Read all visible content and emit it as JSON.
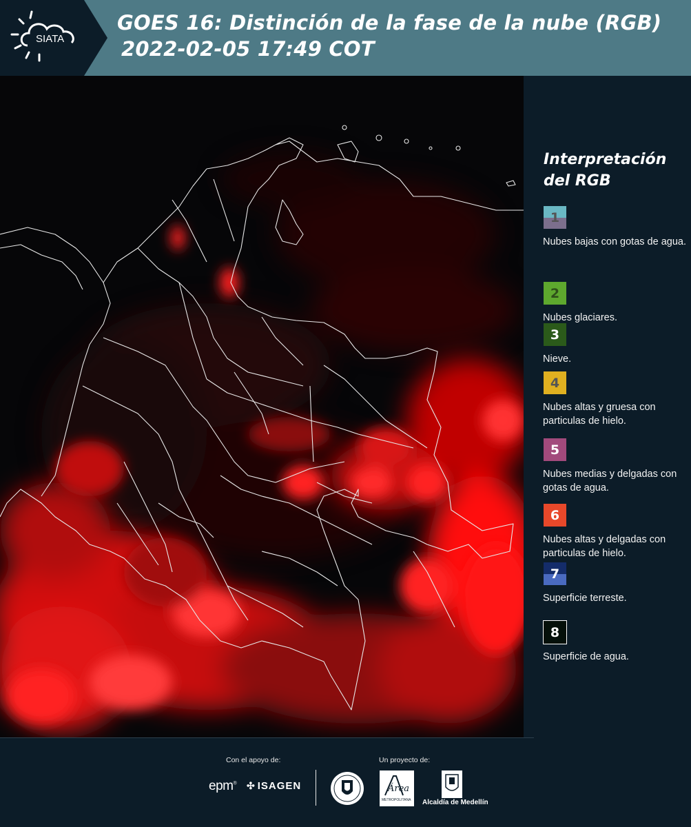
{
  "header": {
    "logo_text": "SIATA",
    "title_line1": "GOES 16: Distinción de la fase de la nube (RGB)",
    "title_line2": "2022-02-05 17:49 COT"
  },
  "legend": {
    "title": "Interpretación del RGB",
    "items": [
      {
        "number": "1",
        "label": "Nubes bajas con gotas de agua.",
        "color_top": "#6ab8c4",
        "color_bottom": "#7c6f8d",
        "number_color": "#555555"
      },
      {
        "number": "2",
        "label": "Nubes glaciares.",
        "color_top": "#5ea82e",
        "color_bottom": "#5ea82e",
        "number_color": "#2f4f1a"
      },
      {
        "number": "3",
        "label": "Nieve.",
        "color_top": "#2b5a1a",
        "color_bottom": "#2b5a1a",
        "number_color": "#ffffff"
      },
      {
        "number": "4",
        "label": "Nubes altas y gruesa con particulas de hielo.",
        "color_top": "#e0b020",
        "color_bottom": "#e0b020",
        "number_color": "#555555"
      },
      {
        "number": "5",
        "label": "Nubes medias y delgadas con gotas de agua.",
        "color_top": "#a24a7c",
        "color_bottom": "#a24a7c",
        "number_color": "#ffffff"
      },
      {
        "number": "6",
        "label": "Nubes altas y delgadas con particulas de hielo.",
        "color_top": "#e8482a",
        "color_bottom": "#e8482a",
        "number_color": "#ffffff"
      },
      {
        "number": "7",
        "label": "Superficie terreste.",
        "color_top": "#142c6a",
        "color_bottom": "#4a6ac0",
        "number_color": "#ffffff"
      },
      {
        "number": "8",
        "label": "Superficie de agua.",
        "color_top": "#05100a",
        "color_bottom": "#05100a",
        "number_color": "#ffffff"
      }
    ]
  },
  "footer": {
    "support_label": "Con el apoyo de:",
    "project_label": "Un proyecto de:",
    "sponsor_1": "epm",
    "sponsor_2": "ISAGEN",
    "area_logo_text": "Área",
    "area_logo_subtext": "METROPOLITANA",
    "alcaldia_label": "Alcaldía de Medellín"
  }
}
